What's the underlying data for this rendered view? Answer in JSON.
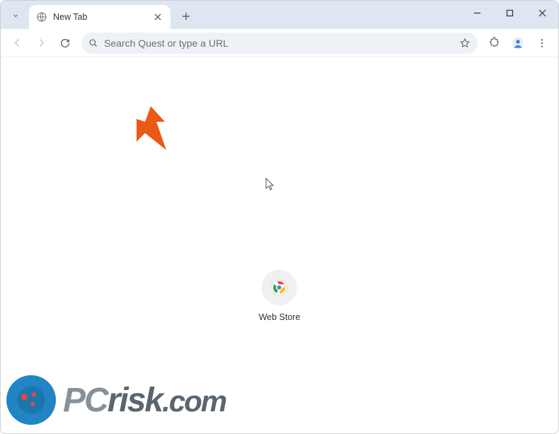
{
  "tab": {
    "title": "New Tab"
  },
  "omnibox": {
    "placeholder": "Search Quest or type a URL"
  },
  "shortcut": {
    "label": "Web Store"
  },
  "watermark": {
    "pc": "PC",
    "risk": "risk",
    "com": ".com"
  }
}
